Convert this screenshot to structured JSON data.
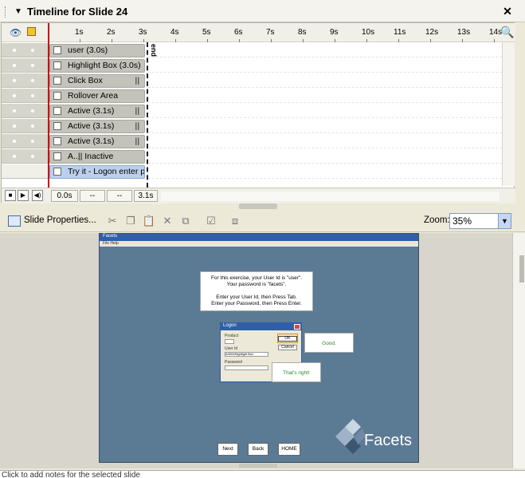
{
  "window": {
    "title": "Timeline for Slide 24"
  },
  "timeline": {
    "ruler_ticks": [
      "1s",
      "2s",
      "3s",
      "4s",
      "5s",
      "6s",
      "7s",
      "8s",
      "9s",
      "10s",
      "11s",
      "12s",
      "13s",
      "14s"
    ],
    "end_label": "end",
    "rows": [
      {
        "label": "user (3.0s)",
        "icon": "caption-icon",
        "pause": ""
      },
      {
        "label": "Highlight Box (3.0s)",
        "icon": "highlight-box-icon",
        "pause": ""
      },
      {
        "label": "Click Box",
        "icon": "click-box-icon",
        "pause": "||"
      },
      {
        "label": "Rollover Area",
        "icon": "rollover-area-icon",
        "pause": ""
      },
      {
        "label": "Active (3.1s)",
        "icon": "checkbox-icon",
        "pause": "||"
      },
      {
        "label": "Active (3.1s)",
        "icon": "checkbox-icon",
        "pause": "||"
      },
      {
        "label": "Active (3.1s)",
        "icon": "checkbox-icon",
        "pause": "||"
      },
      {
        "label": "A..||   Inactive",
        "icon": "text-entry-icon",
        "pause": ""
      },
      {
        "label": "Try it - Logon enter pw",
        "icon": "slide-icon",
        "pause": ""
      }
    ],
    "footer": {
      "time_current": "0.0s",
      "field2": "--",
      "field3": "--",
      "duration": "3.1s"
    }
  },
  "toolbar": {
    "slide_properties_label": "Slide Properties...",
    "zoom_label": "Zoom:",
    "zoom_value": "35%"
  },
  "slide": {
    "titlebar_text": "Facets",
    "menubar_text": "File   Help",
    "instruction_lines": [
      "For this exercise, your User Id is \"user\".",
      "Your password is \"facets\".",
      "",
      "Enter your User Id, then Press Tab.",
      "Enter your Password, then Press Enter."
    ],
    "logon_title": "Logon",
    "logon_product_label": "Product",
    "logon_userid_label": "User Id",
    "logon_userid_value": "A4004Highlight Box",
    "logon_password_label": "Password",
    "ok_label": "OK",
    "cancel_label": "Cancel",
    "good_caption": "Good.",
    "right_caption": "That's right!",
    "buttons": [
      "Next",
      "Back",
      "HOME"
    ],
    "logo_text": "Facets"
  },
  "notes_text": "Click to add notes for the selected slide"
}
